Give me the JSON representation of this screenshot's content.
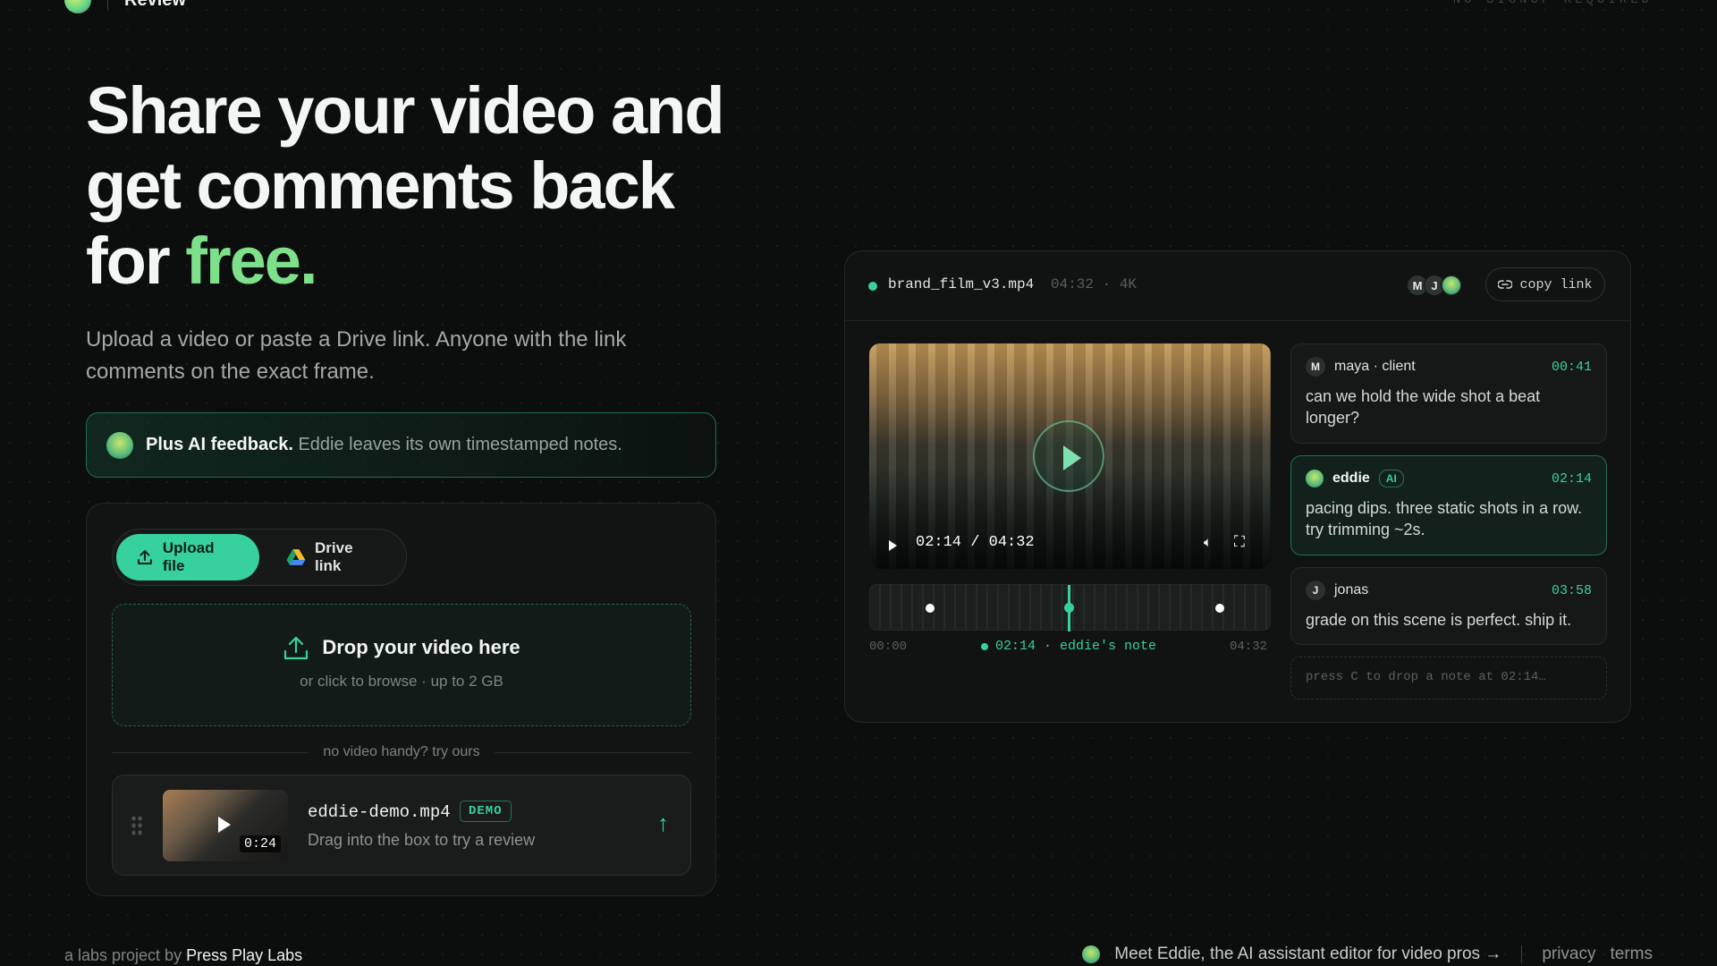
{
  "header": {
    "brand": "Review",
    "right_note": "NO SIGNUP REQUIRED"
  },
  "hero": {
    "title_part1": "Share your video and get comments back for ",
    "title_accent": "free.",
    "subtitle": "Upload a video or paste a Drive link. Anyone with the link comments on the exact frame."
  },
  "ai_banner": {
    "bold": "Plus AI feedback.",
    "text": "Eddie leaves its own timestamped notes."
  },
  "upload": {
    "tabs": [
      {
        "label": "Upload file",
        "active": true
      },
      {
        "label": "Drive link",
        "active": false
      }
    ],
    "drop_title": "Drop your video here",
    "drop_sub": "or click to browse · up to 2 GB",
    "divider": "no video handy? try ours",
    "demo": {
      "filename": "eddie-demo.mp4",
      "badge": "DEMO",
      "description": "Drag into the box to try a review",
      "duration": "0:24"
    }
  },
  "panel": {
    "file_name": "brand_film_v3.mp4",
    "file_meta": "04:32 · 4K",
    "avatars": [
      "M",
      "J"
    ],
    "copy_label": "copy link",
    "player": {
      "time": "02:14 / 04:32",
      "progress": 0.494
    },
    "timeline": {
      "start": "00:00",
      "end": "04:32",
      "note": "02:14 · eddie's note",
      "markers": [
        "00:41",
        "02:14",
        "03:58"
      ]
    },
    "comments": [
      {
        "initial": "M",
        "author": "maya · client",
        "time": "00:41",
        "text": "can we hold the wide shot a beat longer?",
        "ai": false
      },
      {
        "initial": "",
        "author": "eddie",
        "badge": "AI",
        "time": "02:14",
        "text": "pacing dips. three static shots in a row. try trimming ~2s.",
        "ai": true
      },
      {
        "initial": "J",
        "author": "jonas",
        "time": "03:58",
        "text": "grade on this scene is perfect. ship it.",
        "ai": false
      }
    ],
    "note_placeholder": "press C to drop a note at 02:14…"
  },
  "footer": {
    "left_prefix": "a labs project by",
    "left_brand": "Press Play Labs",
    "eddie_link": "Meet Eddie, the AI assistant editor for video pros →",
    "privacy": "privacy",
    "terms": "terms"
  },
  "colors": {
    "accent": "#36d19e",
    "accent_text": "#7ee08a",
    "background": "#0c0d0d"
  }
}
